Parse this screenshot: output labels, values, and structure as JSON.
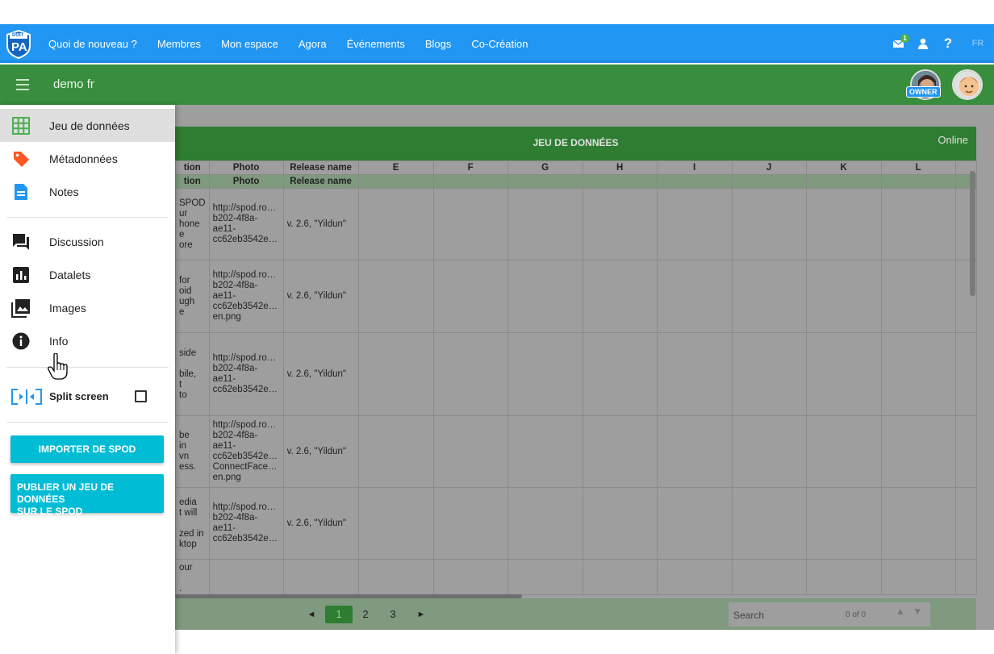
{
  "topnav": {
    "logo_text_top": "DOIT",
    "logo_text_main": "PA",
    "links": [
      "Quoi de nouveau ?",
      "Membres",
      "Mon espace",
      "Agora",
      "Événements",
      "Blogs",
      "Co-Création"
    ],
    "notification_count": "1",
    "help_label": "?",
    "lang": "FR",
    "color": "#2196f3"
  },
  "greenbar": {
    "title": "demo fr",
    "owner_badge": "OWNER",
    "color": "#388e3c"
  },
  "dataset": {
    "title": "JEU DE DONNÉES",
    "status": "Online",
    "columns": [
      "tion",
      "Photo",
      "Release name",
      "E",
      "F",
      "G",
      "H",
      "I",
      "J",
      "K",
      "L"
    ],
    "columns_row2": [
      "tion",
      "Photo",
      "Release name"
    ],
    "rows": [
      {
        "desc": "SPOD\nur\nhone\ne\nore",
        "photo": "http://spod.ro…\nb202-4f8a-\nae11-\ncc62eb3542e…",
        "release": "v. 2.6, \"Yildun\""
      },
      {
        "desc": "for\noid\nugh\ne",
        "photo": "http://spod.ro…\nb202-4f8a-\nae11-\ncc62eb3542e…\nen.png",
        "release": "v. 2.6, \"Yildun\""
      },
      {
        "desc": "side\n\nbile,\nt\nto",
        "photo": "http://spod.ro…\nb202-4f8a-\nae11-\ncc62eb3542e…",
        "release": "v. 2.6, \"Yildun\""
      },
      {
        "desc": "be\nin\nvn\ness.",
        "photo": "http://spod.ro…\nb202-4f8a-\nae11-\ncc62eb3542e…\nConnectFace…\nen.png",
        "release": "v. 2.6, \"Yildun\""
      },
      {
        "desc": "edia\nt will\n\nzed in\nktop",
        "photo": "http://spod.ro…\nb202-4f8a-\nae11-\ncc62eb3542e…",
        "release": "v. 2.6, \"Yildun\""
      },
      {
        "desc": "our\n\n.",
        "photo": "",
        "release": ""
      }
    ],
    "pagination": {
      "prev": "◄",
      "pages": [
        "1",
        "2",
        "3"
      ],
      "next": "►",
      "current": "1"
    },
    "search": {
      "placeholder": "Search",
      "count": "0 of 0"
    }
  },
  "drawer": {
    "items": [
      {
        "label": "Jeu de données",
        "icon": "grid-icon",
        "color": "#4caf50"
      },
      {
        "label": "Métadonnées",
        "icon": "tag-icon",
        "color": "#ff5722"
      },
      {
        "label": "Notes",
        "icon": "document-icon",
        "color": "#2196f3"
      },
      {
        "label": "Discussion",
        "icon": "forum-icon",
        "color": "#212121"
      },
      {
        "label": "Datalets",
        "icon": "bar-chart-icon",
        "color": "#212121"
      },
      {
        "label": "Images",
        "icon": "image-gallery-icon",
        "color": "#212121"
      },
      {
        "label": "Info",
        "icon": "info-icon",
        "color": "#212121"
      }
    ],
    "split_screen": {
      "label": "Split screen",
      "checked": false
    },
    "buttons": {
      "import": "IMPORTER DE SPOD",
      "publish_line1": "PUBLIER UN JEU DE DONNÉES",
      "publish_line2": "SUR LE SPOD"
    }
  }
}
